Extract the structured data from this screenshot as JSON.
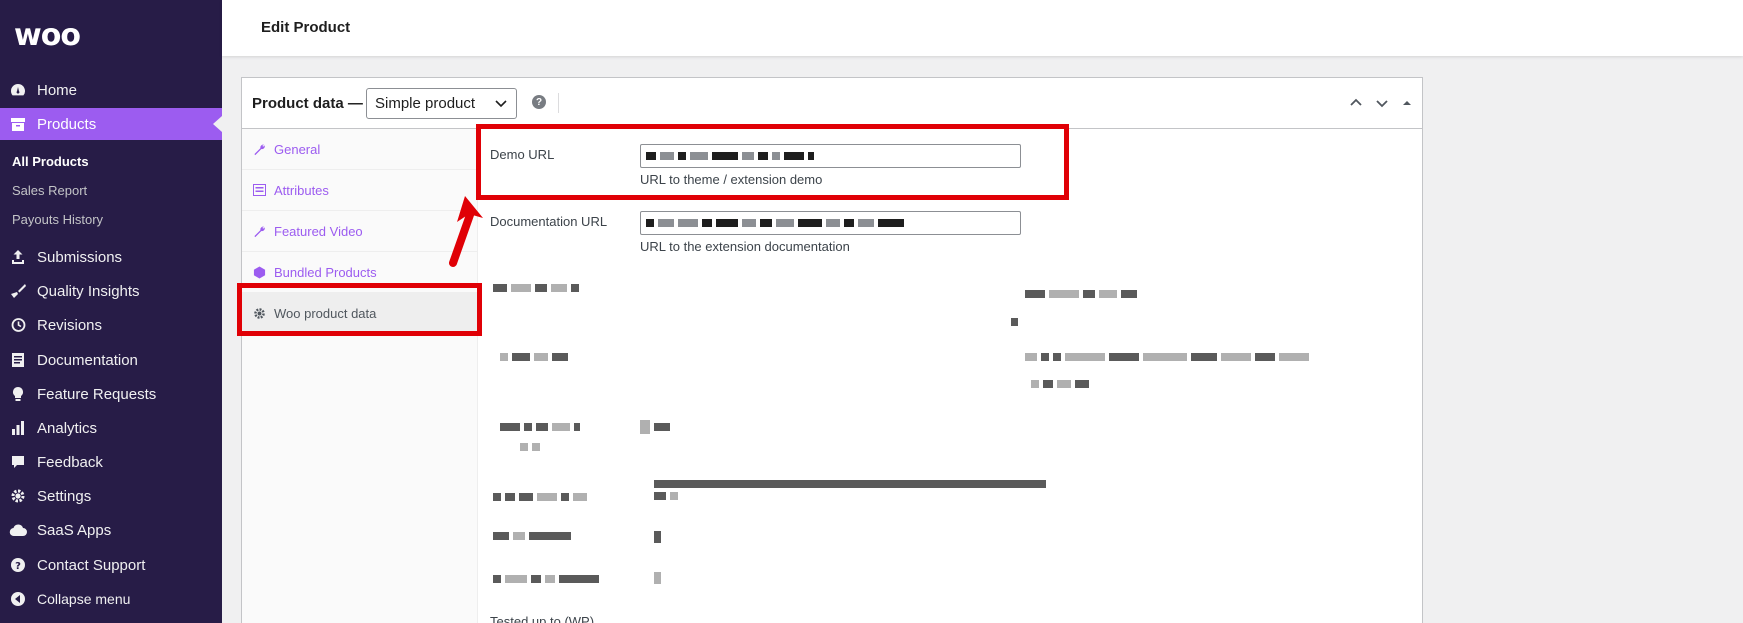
{
  "brand": {
    "logo_text": "woo",
    "accent": "#9c5cf0",
    "sidebar_bg": "#271c47",
    "highlight": "#e00006"
  },
  "sidebar": {
    "items": [
      {
        "label": "Home",
        "icon": "dashboard-icon"
      },
      {
        "label": "Products",
        "icon": "archive-icon"
      },
      {
        "label": "Submissions",
        "icon": "upload-icon"
      },
      {
        "label": "Quality Insights",
        "icon": "broom-icon"
      },
      {
        "label": "Revisions",
        "icon": "history-icon"
      },
      {
        "label": "Documentation",
        "icon": "document-icon"
      },
      {
        "label": "Feature Requests",
        "icon": "lightbulb-icon"
      },
      {
        "label": "Analytics",
        "icon": "bar-chart-icon"
      },
      {
        "label": "Feedback",
        "icon": "comment-icon"
      },
      {
        "label": "Settings",
        "icon": "gear-icon"
      },
      {
        "label": "SaaS Apps",
        "icon": "cloud-icon"
      },
      {
        "label": "Contact Support",
        "icon": "help-icon"
      },
      {
        "label": "Collapse menu",
        "icon": "collapse-icon"
      }
    ],
    "submenu": [
      "All Products",
      "Sales Report",
      "Payouts History"
    ]
  },
  "header": {
    "title": "Edit Product"
  },
  "product_data": {
    "label": "Product data —",
    "type_selected": "Simple product",
    "help": "?"
  },
  "tabs": [
    {
      "label": "General",
      "icon": "wrench-icon"
    },
    {
      "label": "Attributes",
      "icon": "list-icon"
    },
    {
      "label": "Featured Video",
      "icon": "wrench-icon"
    },
    {
      "label": "Bundled Products",
      "icon": "hexagon-icon"
    },
    {
      "label": "Woo product data",
      "icon": "gear-icon"
    }
  ],
  "fields": {
    "demo_url": {
      "label": "Demo URL",
      "description": "URL to theme / extension demo"
    },
    "documentation_url": {
      "label": "Documentation URL",
      "description": "URL to the extension documentation"
    }
  },
  "tested_label": "Tested up to (WP)"
}
